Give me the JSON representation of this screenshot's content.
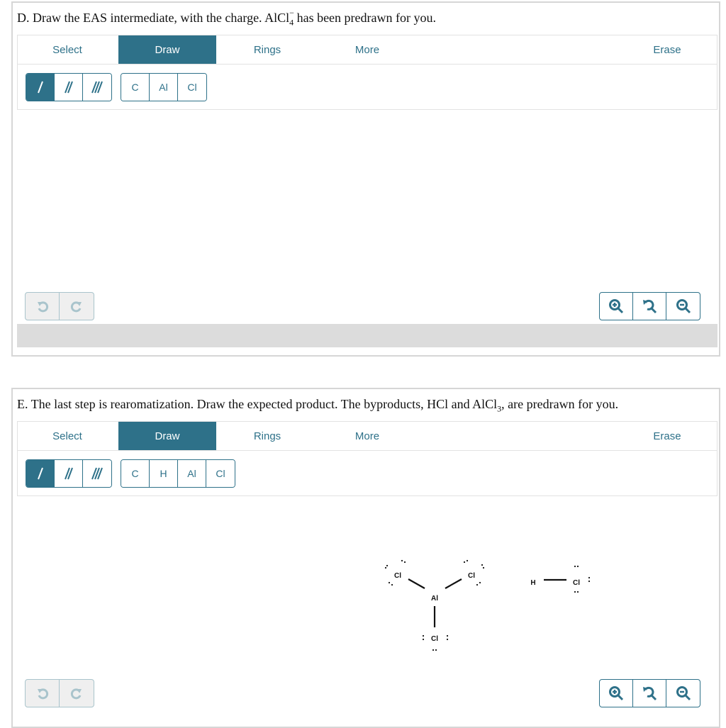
{
  "panel_d": {
    "question_pre": "D. Draw the EAS intermediate, with the charge. AlCl",
    "question_sub": "4",
    "question_sup": "−",
    "question_post": " has been predrawn for you.",
    "tabs": {
      "select": "Select",
      "draw": "Draw",
      "rings": "Rings",
      "more": "More",
      "erase": "Erase"
    },
    "atoms": [
      "C",
      "Al",
      "Cl"
    ]
  },
  "panel_e": {
    "question_pre": "E. The last step is rearomatization. Draw the expected product. The byproducts, HCl and AlCl",
    "question_sub": "3",
    "question_post": ", are predrawn for you.",
    "tabs": {
      "select": "Select",
      "draw": "Draw",
      "rings": "Rings",
      "more": "More",
      "erase": "Erase"
    },
    "atoms": [
      "C",
      "H",
      "Al",
      "Cl"
    ],
    "molecules": {
      "al": "Al",
      "cl": "Cl",
      "h": "H"
    }
  },
  "colors": {
    "accent": "#2e7189",
    "disabled": "#a9c4cc",
    "footer": "#dcdcdc"
  },
  "icons": [
    "single-bond-icon",
    "double-bond-icon",
    "triple-bond-icon",
    "undo-icon",
    "redo-icon",
    "zoom-in-icon",
    "reset-zoom-icon",
    "zoom-out-icon"
  ]
}
